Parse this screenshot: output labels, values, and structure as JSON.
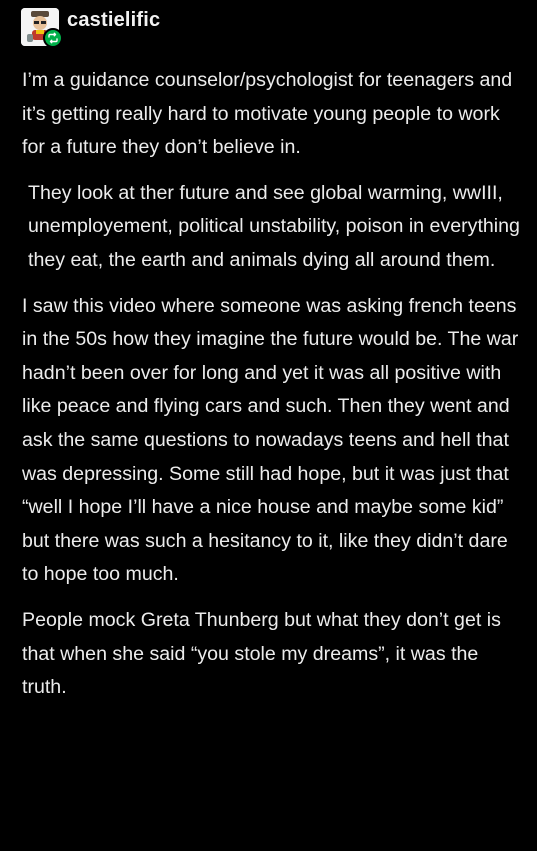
{
  "post": {
    "username": "castielific",
    "avatar_icon": "avatar-icon",
    "badge_icon": "reblog-icon",
    "badge_color": "#00b04a",
    "background_color": "#000000",
    "text_color": "#ececec",
    "paragraphs": [
      "I’m a guidance counselor/psychologist for teenagers and it’s getting really hard to motivate young people to work for a future they don’t believe in.",
      "They look at ther future and see global warming, wwIII, unemployement, political unstability, poison in everything  they eat, the earth and animals dying all around them.",
      "I saw this video where someone was asking french teens in the 50s how they imagine the future would be. The war hadn’t been over for long and yet it was all positive with like peace and flying cars and such. Then they went and ask the same questions to nowadays teens and hell that was depressing. Some still had hope, but it was just that “well I hope I’ll have a nice house and maybe some kid” but there was such a hesitancy to it, like they didn’t dare to hope too much.",
      "People mock Greta Thunberg but what they don’t get is that when she said “you stole my dreams”, it was the truth."
    ]
  }
}
